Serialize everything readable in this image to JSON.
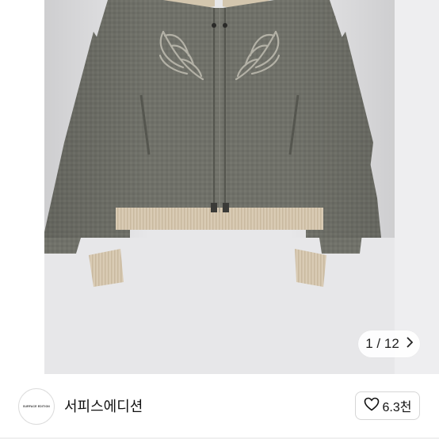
{
  "gallery": {
    "image_alt": "jacket",
    "counter": {
      "current": "1",
      "separator": "/",
      "total": "12"
    },
    "next_icon": "chevron-right-icon"
  },
  "seller": {
    "avatar_text": "SURFACE EDITION",
    "name": "서피스에디션"
  },
  "like": {
    "icon": "heart-icon",
    "count": "6.3천"
  },
  "colors": {
    "photo_bg": "#e7e7e9",
    "jacket": "#6f7069",
    "rib": "#d8c9b2"
  }
}
